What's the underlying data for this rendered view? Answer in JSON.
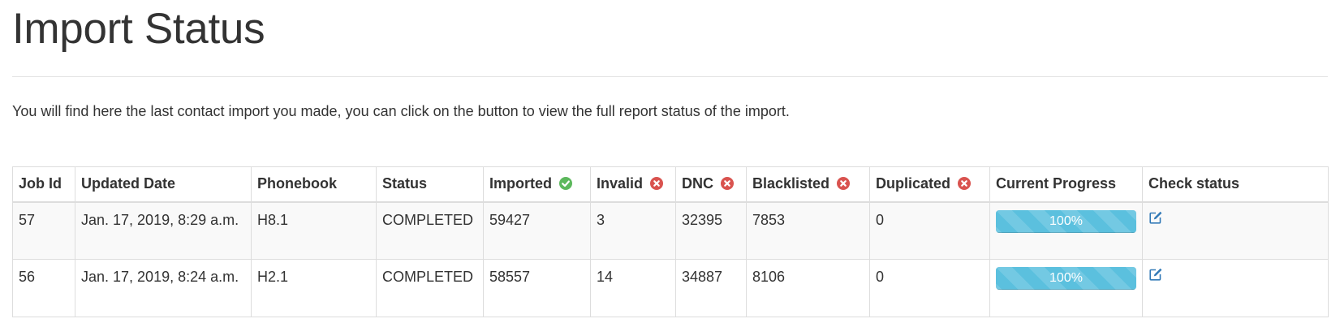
{
  "page": {
    "title": "Import Status",
    "intro": "You will find here the last contact import you made, you can click on the button to view the full report status of the import."
  },
  "table": {
    "headers": {
      "job_id": "Job Id",
      "updated_date": "Updated Date",
      "phonebook": "Phonebook",
      "status": "Status",
      "imported": "Imported",
      "invalid": "Invalid",
      "dnc": "DNC",
      "blacklisted": "Blacklisted",
      "duplicated": "Duplicated",
      "current_progress": "Current Progress",
      "check_status": "Check status"
    },
    "header_icons": {
      "imported": "check-circle-icon",
      "invalid": "times-circle-icon",
      "dnc": "times-circle-icon",
      "blacklisted": "times-circle-icon",
      "duplicated": "times-circle-icon"
    },
    "rows": [
      {
        "job_id": "57",
        "updated_date": "Jan. 17, 2019, 8:29 a.m.",
        "phonebook": "H8.1",
        "status": "COMPLETED",
        "imported": "59427",
        "invalid": "3",
        "dnc": "32395",
        "blacklisted": "7853",
        "duplicated": "0",
        "progress_label": "100%",
        "progress_value": 100,
        "check_icon": "edit-icon"
      },
      {
        "job_id": "56",
        "updated_date": "Jan. 17, 2019, 8:24 a.m.",
        "phonebook": "H2.1",
        "status": "COMPLETED",
        "imported": "58557",
        "invalid": "14",
        "dnc": "34887",
        "blacklisted": "8106",
        "duplicated": "0",
        "progress_label": "100%",
        "progress_value": 100,
        "check_icon": "edit-icon"
      }
    ]
  },
  "colors": {
    "success": "#5cb85c",
    "danger": "#d9534f",
    "progress": "#5bc0de",
    "link": "#337ab7"
  }
}
